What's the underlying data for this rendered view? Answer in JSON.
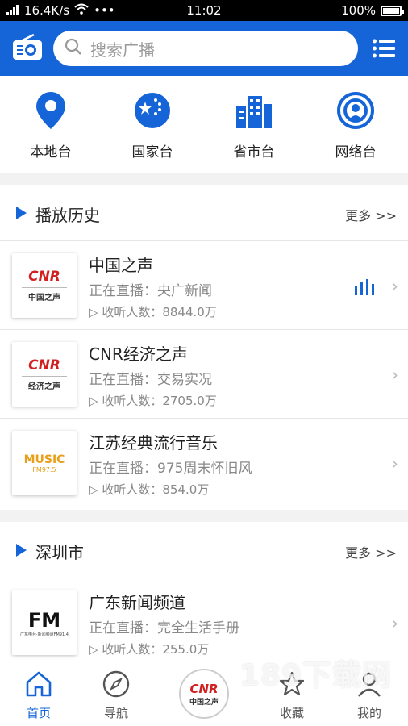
{
  "status_bar": {
    "speed": "16.4K/s",
    "time": "11:02",
    "battery": "100%"
  },
  "search": {
    "placeholder": "搜索广播"
  },
  "categories": [
    {
      "label": "本地台",
      "icon": "location-pin-icon"
    },
    {
      "label": "国家台",
      "icon": "china-flag-icon"
    },
    {
      "label": "省市台",
      "icon": "building-icon"
    },
    {
      "label": "网络台",
      "icon": "podcast-icon"
    }
  ],
  "history": {
    "title": "播放历史",
    "more": "更多 >>",
    "items": [
      {
        "name": "中国之声",
        "live": "正在直播：央广新闻",
        "listeners": "收听人数：8844.0万",
        "logo_text": "CNR",
        "logo_sub": "中国之声",
        "playing": true
      },
      {
        "name": "CNR经济之声",
        "live": "正在直播：交易实况",
        "listeners": "收听人数：2705.0万",
        "logo_text": "CNR",
        "logo_sub": "经济之声",
        "playing": false
      },
      {
        "name": "江苏经典流行音乐",
        "live": "正在直播：975周末怀旧风",
        "listeners": "收听人数：854.0万",
        "logo_text": "MUSIC",
        "logo_sub": "FM97.5",
        "playing": false
      }
    ]
  },
  "local": {
    "title": "深圳市",
    "more": "更多 >>",
    "items": [
      {
        "name": "广东新闻频道",
        "live": "正在直播：完全生活手册",
        "listeners": "收听人数：255.0万",
        "logo_text": "FM",
        "logo_sub": "广东电台·新闻频道FM91.4"
      }
    ]
  },
  "nav": [
    {
      "label": "首页",
      "icon": "home-icon",
      "active": true
    },
    {
      "label": "导航",
      "icon": "compass-icon",
      "active": false
    },
    {
      "label": "收藏",
      "icon": "star-icon",
      "active": false
    },
    {
      "label": "我的",
      "icon": "user-icon",
      "active": false
    }
  ],
  "center_logo": {
    "text": "CNR",
    "sub": "中国之声"
  },
  "watermark": "189下载网",
  "colors": {
    "brand": "#1565d8",
    "cnr_red": "#d21f1f"
  }
}
